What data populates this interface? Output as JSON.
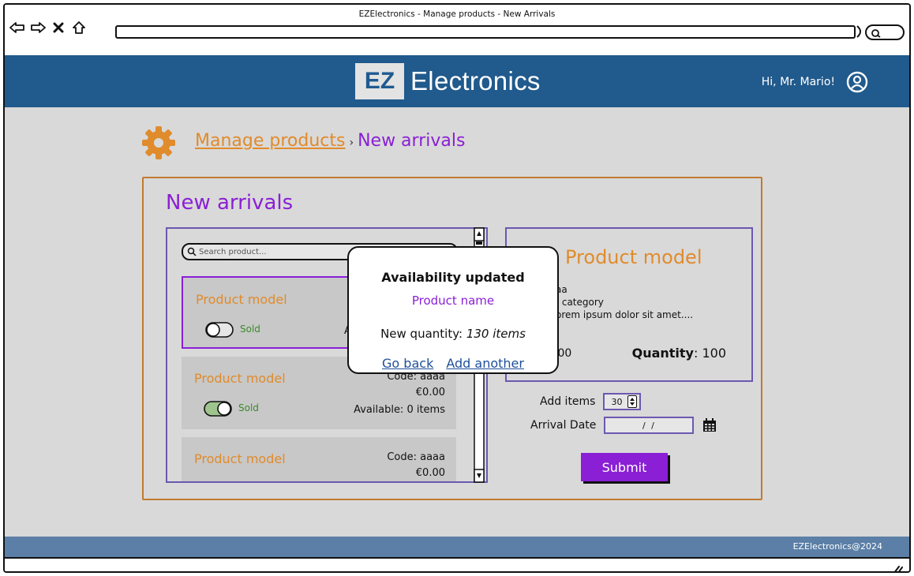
{
  "window": {
    "title": "EZElectronics - Manage products - New Arrivals"
  },
  "browser": {
    "icons": [
      "back-icon",
      "forward-icon",
      "close-icon",
      "home-icon",
      "search-icon"
    ]
  },
  "header": {
    "logo_mark": "EZ",
    "logo_text": "Electronics",
    "greeting": "Hi, Mr. Mario!",
    "user_icon": "user-circle-icon"
  },
  "breadcrumb": {
    "icon": "gear-icon",
    "parent": "Manage products",
    "separator": "›",
    "current": "New arrivals"
  },
  "panel": {
    "title": "New arrivals",
    "search_placeholder": "Search product..."
  },
  "products": [
    {
      "model": "Product model",
      "status": "Sold",
      "toggle_on": false,
      "code": "",
      "price": "",
      "available": "A"
    },
    {
      "model": "Product model",
      "status": "Sold",
      "toggle_on": true,
      "code": "Code: aaaa",
      "price": "€0.00",
      "available": "Available: 0 items"
    },
    {
      "model": "Product model",
      "status": "",
      "toggle_on": false,
      "code": "Code: aaaa",
      "price": "€0.00",
      "available": ""
    }
  ],
  "detail": {
    "title": "Product model",
    "line1": "aa",
    "line2": ": category",
    "line3": "orem ipsum dolor sit amet....",
    "price": ".00",
    "quantity_label": "Quantity",
    "quantity_value": ": 100"
  },
  "form": {
    "add_items_label": "Add items",
    "add_items_value": "30",
    "arrival_date_label": "Arrival Date",
    "arrival_date_value": "/ /",
    "calendar_icon": "calendar-icon",
    "submit_label": "Submit"
  },
  "modal": {
    "title": "Availability updated",
    "product_name": "Product name",
    "qty_prefix": "New quantity: ",
    "qty_value": "130 items",
    "go_back": "Go back",
    "add_another": "Add another"
  },
  "footer": {
    "text": "EZElectronics@2024"
  },
  "colors": {
    "header": "#215a8c",
    "footer": "#5b7fa6",
    "accent_purple": "#8a1fd6",
    "accent_orange": "#e08b2c",
    "background": "#d9d9d9"
  }
}
